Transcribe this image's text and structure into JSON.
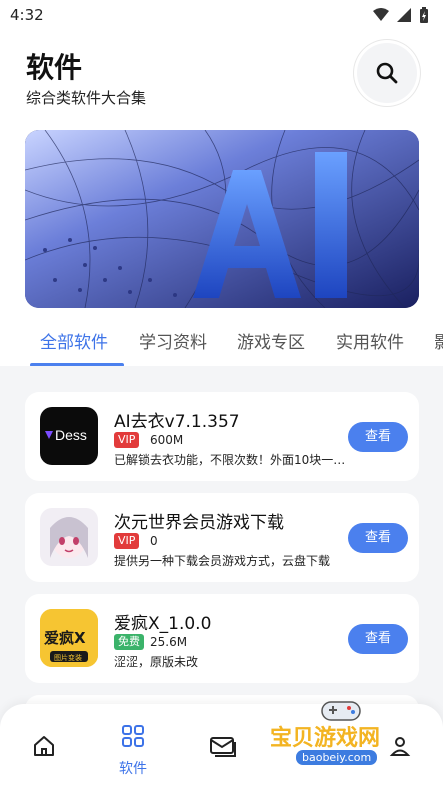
{
  "status_bar": {
    "time": "4:32"
  },
  "header": {
    "title": "软件",
    "subtitle": "综合类软件大合集"
  },
  "tabs": [
    {
      "label": "全部软件",
      "active": true
    },
    {
      "label": "学习资料",
      "active": false
    },
    {
      "label": "游戏专区",
      "active": false
    },
    {
      "label": "实用软件",
      "active": false
    },
    {
      "label": "影",
      "active": false
    }
  ],
  "apps": [
    {
      "name": "AI去衣v7.1.357",
      "badge": "VIP",
      "size": "600M",
      "desc": "已解锁去衣功能，不限次数！外面10块一…",
      "button": "查看",
      "icon_text": "Dess"
    },
    {
      "name": "次元世界会员游戏下载",
      "badge": "VIP",
      "size": "0",
      "desc": "提供另一种下载会员游戏方式，云盘下载",
      "button": "查看"
    },
    {
      "name": "爱疯X_1.0.0",
      "badge": "免费",
      "size": "25.6M",
      "desc": "涩涩，原版未改",
      "button": "查看",
      "icon_text": "爱疯X",
      "icon_subtext": "图片变装"
    }
  ],
  "bottom_nav": {
    "active_label": "软件"
  },
  "watermark": {
    "text": "宝贝游戏网",
    "url": "baobeiy.com"
  },
  "colors": {
    "accent": "#4b80ee",
    "vip": "#e23b3b",
    "free": "#3bb36a"
  }
}
